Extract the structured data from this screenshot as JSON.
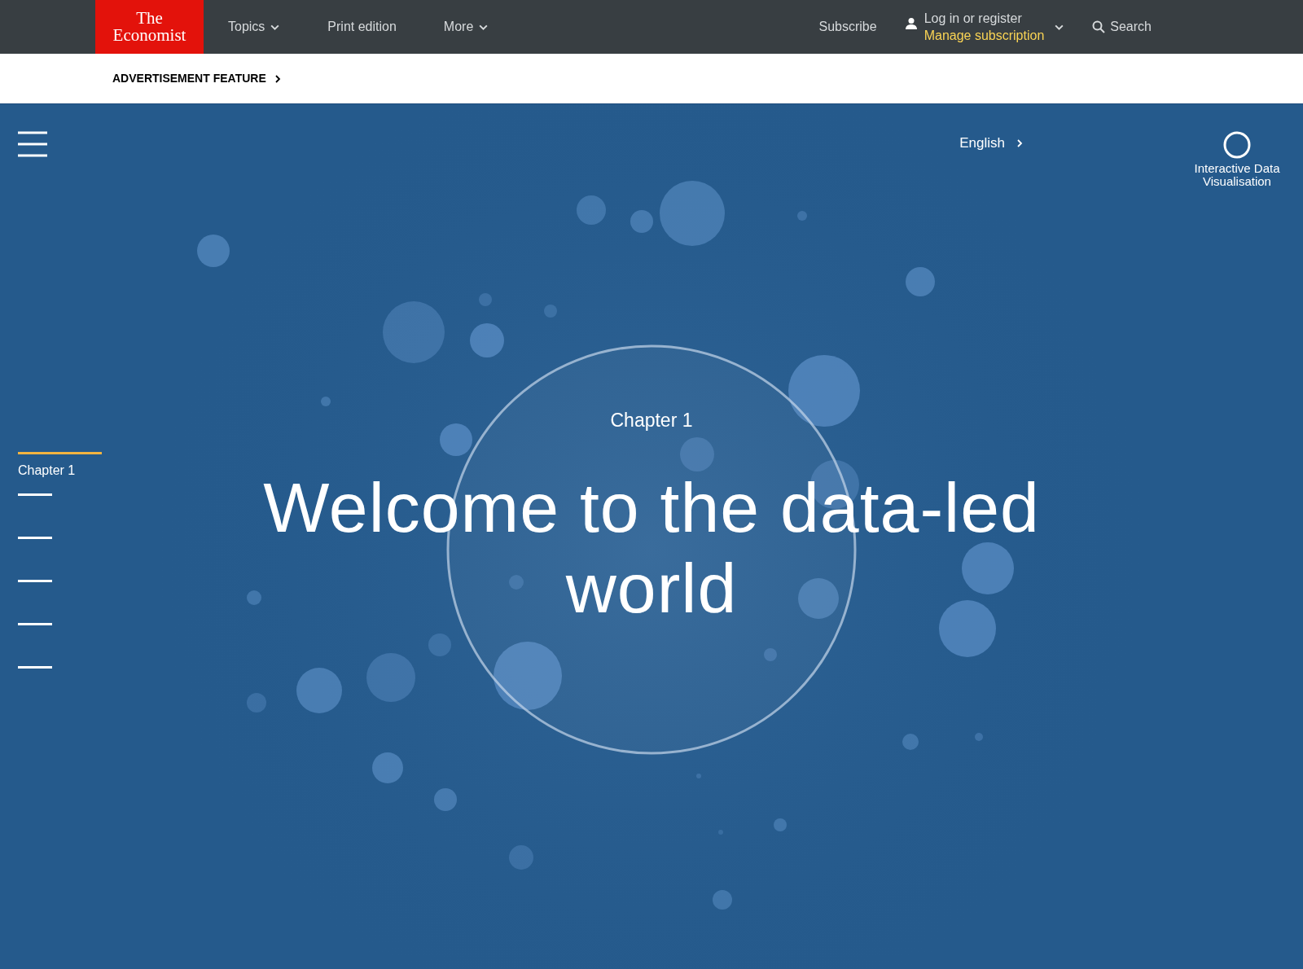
{
  "topbar": {
    "logo": [
      "The",
      "Economist"
    ],
    "nav": [
      {
        "label": "Topics",
        "dropdown": true
      },
      {
        "label": "Print edition",
        "dropdown": false
      },
      {
        "label": "More",
        "dropdown": true
      }
    ],
    "subscribe": "Subscribe",
    "account": {
      "login": "Log in or register",
      "manage": "Manage subscription"
    },
    "search": "Search"
  },
  "ad_bar": {
    "label": "ADVERTISEMENT FEATURE"
  },
  "hero": {
    "language": "English",
    "badge": "Interactive Data Visualisation",
    "eyebrow": "Chapter 1",
    "headline": [
      "Welcome to the data-led",
      "world"
    ]
  },
  "chapter_nav": [
    {
      "label": "Chapter 1",
      "selected": true
    },
    {
      "selected": false
    },
    {
      "selected": false
    },
    {
      "selected": false
    },
    {
      "selected": false
    },
    {
      "selected": false
    }
  ]
}
